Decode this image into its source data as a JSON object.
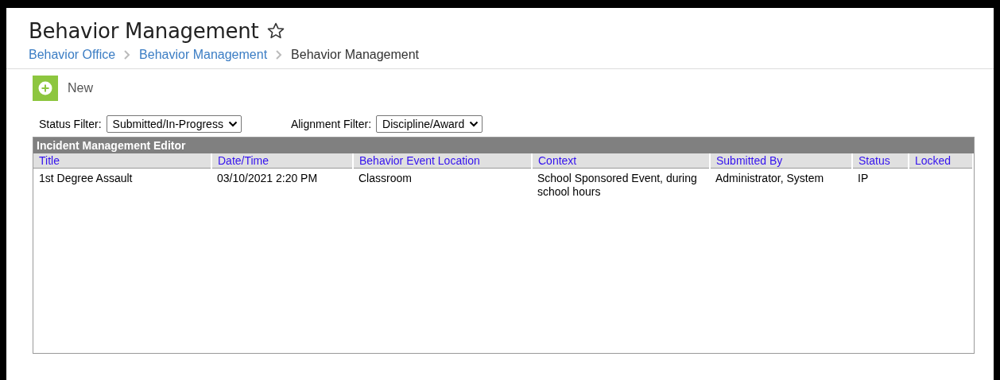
{
  "page": {
    "title": "Behavior Management",
    "favorite": false
  },
  "breadcrumb": [
    {
      "label": "Behavior Office",
      "link": true
    },
    {
      "label": "Behavior Management",
      "link": true
    },
    {
      "label": "Behavior Management",
      "link": false
    }
  ],
  "toolbar": {
    "new_label": "New"
  },
  "filters": [
    {
      "label": "Status Filter:",
      "value": "Submitted/In-Progress"
    },
    {
      "label": "Alignment Filter:",
      "value": "Discipline/Award"
    }
  ],
  "table": {
    "title": "Incident Management Editor",
    "columns": [
      "Title",
      "Date/Time",
      "Behavior Event Location",
      "Context",
      "Submitted By",
      "Status",
      "Locked"
    ],
    "rows": [
      [
        "1st Degree Assault",
        "03/10/2021 2:20 PM",
        "Classroom",
        "School Sponsored Event, during school hours",
        "Administrator, System",
        "IP",
        ""
      ]
    ]
  }
}
